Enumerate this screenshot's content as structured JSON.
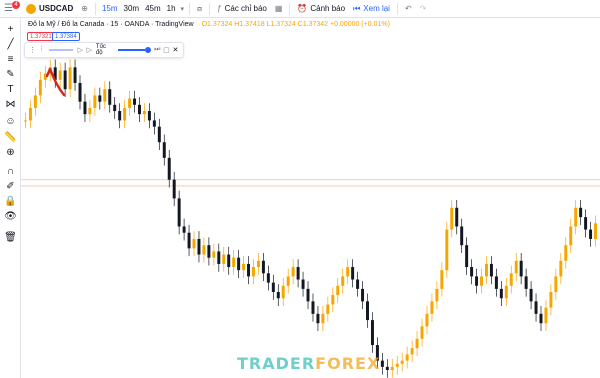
{
  "toolbar": {
    "notification_count": "4",
    "symbol": "USDCAD",
    "timeframes": [
      "15m",
      "30m",
      "45m",
      "1h"
    ],
    "indicators_label": "Các chỉ báo",
    "alerts_label": "Cảnh báo",
    "replay_label": "Xem lại"
  },
  "legend": {
    "title": "Đô la Mỹ / Đô la Canada · 15 · OANDA · TradingView",
    "ohlc": "O1.37324 H1.37418 L1.37324 C1.37342 +0.00000 (+0.01%)"
  },
  "price_tags": {
    "sell": "1.37321",
    "buy": "1.37384"
  },
  "replay_bar": {
    "speed_label": "Tốc độ",
    "speed_value": 1.0
  },
  "sidebar": {
    "tools": [
      "crosshair-icon",
      "trendline-icon",
      "fib-icon",
      "brush-icon",
      "text-icon",
      "pattern-icon",
      "emoji-icon",
      "ruler-icon",
      "zoom-in-icon",
      "magnet-icon",
      "pencil-lock-icon",
      "lock-icon",
      "eye-icon",
      "trash-icon"
    ]
  },
  "watermark": {
    "part1": "TRADER",
    "part2": "FOREX"
  },
  "colors": {
    "up": "#f7a600",
    "down": "#131722",
    "accent": "#2962ff",
    "sell": "#f23645"
  },
  "chart_data": {
    "type": "candlestick",
    "series": [
      {
        "name": "",
        "values": [
          0.8,
          0.84,
          0.88,
          0.93,
          0.95,
          0.97,
          0.93,
          0.96,
          0.9,
          0.97,
          0.92,
          0.86,
          0.82,
          0.84,
          0.88,
          0.86,
          0.9,
          0.85,
          0.83,
          0.8,
          0.84,
          0.87,
          0.85,
          0.82,
          0.83,
          0.8,
          0.78,
          0.73,
          0.68,
          0.61,
          0.55,
          0.46,
          0.44,
          0.39,
          0.42,
          0.37,
          0.4,
          0.36,
          0.38,
          0.34,
          0.37,
          0.33,
          0.36,
          0.32,
          0.34,
          0.3,
          0.33,
          0.35,
          0.31,
          0.28,
          0.25,
          0.23,
          0.27,
          0.3,
          0.33,
          0.29,
          0.26,
          0.22,
          0.18,
          0.15,
          0.18,
          0.21,
          0.24,
          0.27,
          0.3,
          0.33,
          0.29,
          0.26,
          0.22,
          0.16,
          0.08,
          0.03,
          0.01,
          0.0,
          0.01,
          0.02,
          0.03,
          0.05,
          0.07,
          0.1,
          0.14,
          0.18,
          0.22,
          0.26,
          0.32,
          0.45,
          0.52,
          0.46,
          0.4,
          0.33,
          0.3,
          0.27,
          0.3,
          0.34,
          0.3,
          0.26,
          0.23,
          0.27,
          0.31,
          0.35,
          0.3,
          0.26,
          0.22,
          0.18,
          0.15,
          0.2,
          0.25,
          0.3,
          0.35,
          0.4,
          0.46,
          0.52,
          0.49,
          0.45,
          0.42,
          0.47
        ]
      }
    ],
    "levels": [
      {
        "name": "",
        "value": 0.61,
        "color": "#f5c7a0"
      },
      {
        "name": "",
        "value": 0.59,
        "color": "#f5c7a0"
      }
    ]
  }
}
